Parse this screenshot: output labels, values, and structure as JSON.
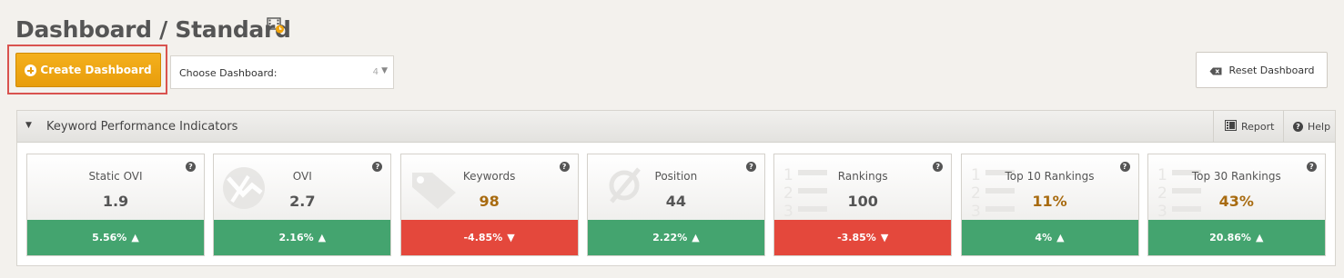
{
  "header": {
    "title": "Dashboard / Standard",
    "title_icon": "film-clock-icon"
  },
  "toolbar": {
    "create_label": "Create Dashboard",
    "choose_label": "Choose Dashboard:",
    "choose_count": "4",
    "reset_label": "Reset Dashboard"
  },
  "panel": {
    "title": "Keyword Performance Indicators",
    "report_label": "Report",
    "help_label": "Help"
  },
  "colors": {
    "primary": "#e89d0c",
    "positive": "#44a46f",
    "negative": "#e4483c",
    "highlight_border": "#d9534f"
  },
  "kpis": [
    {
      "label": "Static OVI",
      "value": "1.9",
      "change": "5.56%",
      "direction": "up",
      "icon": "none",
      "accent": false
    },
    {
      "label": "OVI",
      "value": "2.7",
      "change": "2.16%",
      "direction": "up",
      "icon": "ovi-chart-icon",
      "accent": false
    },
    {
      "label": "Keywords",
      "value": "98",
      "change": "-4.85%",
      "direction": "down",
      "icon": "tags-icon",
      "accent": true
    },
    {
      "label": "Position",
      "value": "44",
      "change": "2.22%",
      "direction": "up",
      "icon": "average-icon",
      "accent": false
    },
    {
      "label": "Rankings",
      "value": "100",
      "change": "-3.85%",
      "direction": "down",
      "icon": "numbered-list-icon",
      "accent": false
    },
    {
      "label": "Top 10 Rankings",
      "value": "11%",
      "change": "4%",
      "direction": "up",
      "icon": "numbered-list-icon",
      "accent": true
    },
    {
      "label": "Top 30 Rankings",
      "value": "43%",
      "change": "20.86%",
      "direction": "up",
      "icon": "numbered-list-icon",
      "accent": true
    }
  ]
}
